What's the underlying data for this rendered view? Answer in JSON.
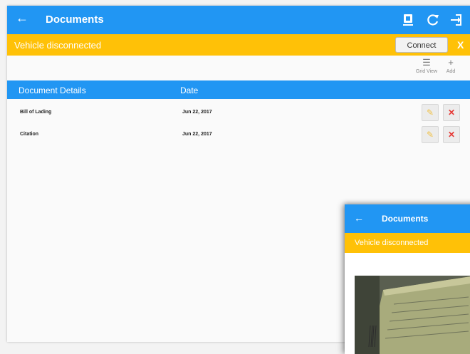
{
  "appbar": {
    "back_icon": "arrow-left-icon",
    "back_glyph": "←",
    "title": "Documents",
    "icons": [
      "device-icon",
      "refresh-icon",
      "logout-icon"
    ]
  },
  "banner": {
    "text": "Vehicle disconnected",
    "connect_label": "Connect",
    "close_label": "X",
    "color": "#ffc107"
  },
  "toolbar": {
    "grid_view_label": "Grid View",
    "grid_view_glyph": "☰",
    "add_label": "Add",
    "add_glyph": "+"
  },
  "table": {
    "headers": [
      "Document Details",
      "Date"
    ],
    "rows": [
      {
        "document": "Bill of Lading",
        "date": "Jun 22, 2017"
      },
      {
        "document": "Citation",
        "date": "Jun 22, 2017"
      }
    ],
    "edit_glyph": "✎",
    "delete_glyph": "✕"
  },
  "overlay": {
    "back_glyph": "←",
    "title": "Documents",
    "banner_text": "Vehicle disconnected"
  },
  "colors": {
    "primary": "#2196f3",
    "warning": "#ffc107",
    "delete": "#e53935",
    "edit": "#f0c24a"
  }
}
